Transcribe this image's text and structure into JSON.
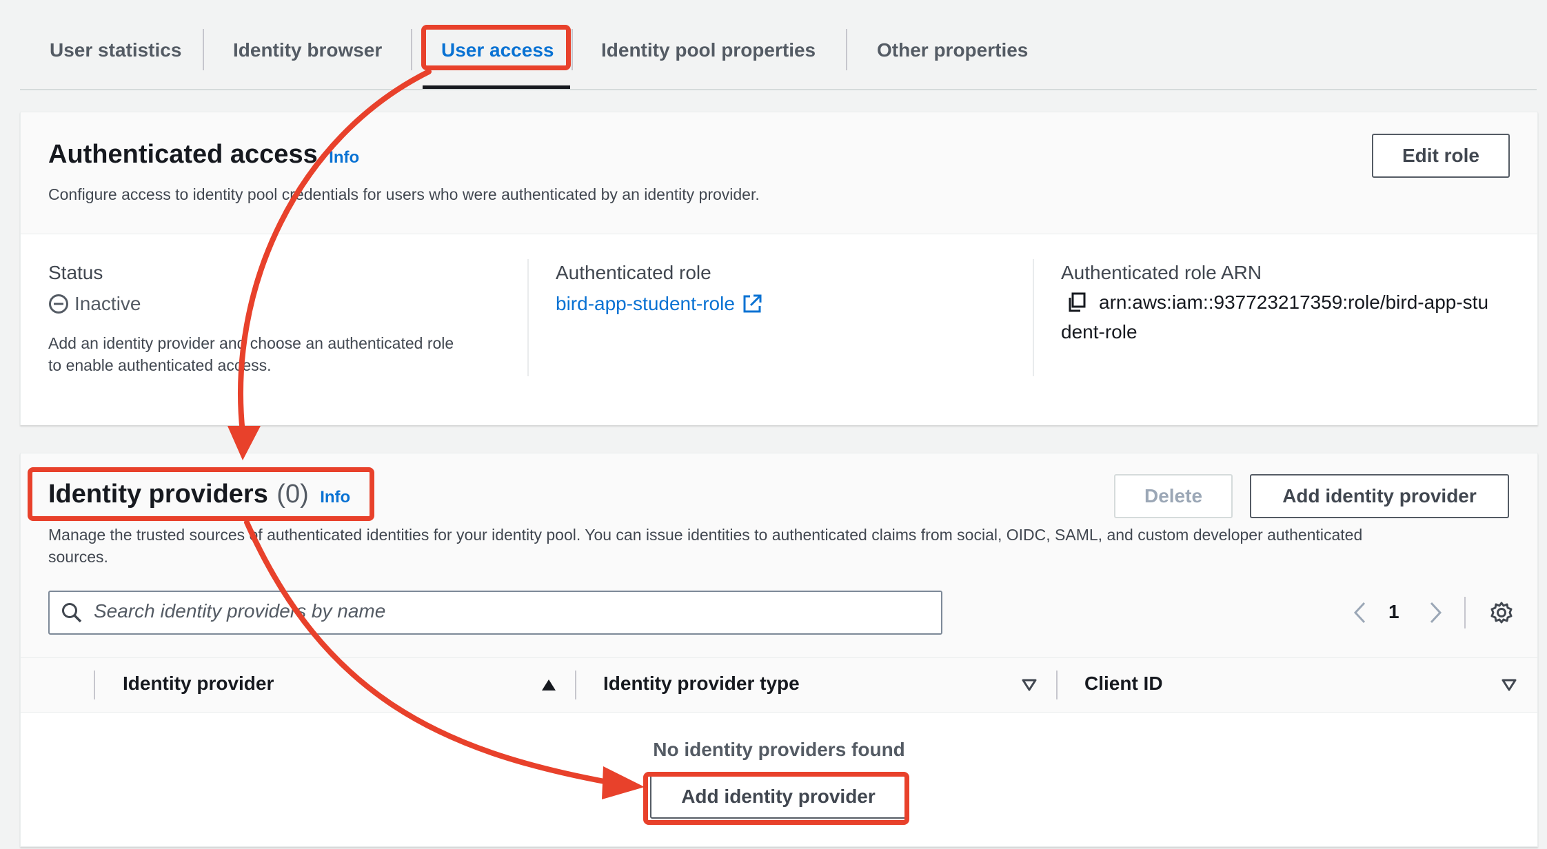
{
  "tabs": [
    {
      "label": "User statistics",
      "active": false
    },
    {
      "label": "Identity browser",
      "active": false
    },
    {
      "label": "User access",
      "active": true
    },
    {
      "label": "Identity pool properties",
      "active": false
    },
    {
      "label": "Other properties",
      "active": false
    }
  ],
  "authenticated_access": {
    "title": "Authenticated access",
    "info": "Info",
    "description": "Configure access to identity pool credentials for users who were authenticated by an identity provider.",
    "edit_button": "Edit role",
    "status_label": "Status",
    "status_value": "Inactive",
    "status_help_line1": "Add an identity provider and choose an authenticated role",
    "status_help_line2": "to enable authenticated access.",
    "role_label": "Authenticated role",
    "role_value": "bird-app-student-role",
    "arn_label": "Authenticated role ARN",
    "arn_line1": "arn:aws:iam::937723217359:role/bird-app-stu",
    "arn_line2": "dent-role"
  },
  "identity_providers": {
    "title": "Identity providers",
    "count": "(0)",
    "info": "Info",
    "delete_button": "Delete",
    "add_button": "Add identity provider",
    "description_line1": "Manage the trusted sources of authenticated identities for your identity pool. You can issue identities to authenticated claims from social, OIDC, SAML, and custom developer authenticated",
    "description_line2": "sources.",
    "search_placeholder": "Search identity providers by name",
    "page_number": "1",
    "columns": [
      "Identity provider",
      "Identity provider type",
      "Client ID"
    ],
    "empty_text": "No identity providers found",
    "empty_add_button": "Add identity provider"
  },
  "colors": {
    "accent": "#0972d3",
    "annotation": "#e8412b"
  }
}
